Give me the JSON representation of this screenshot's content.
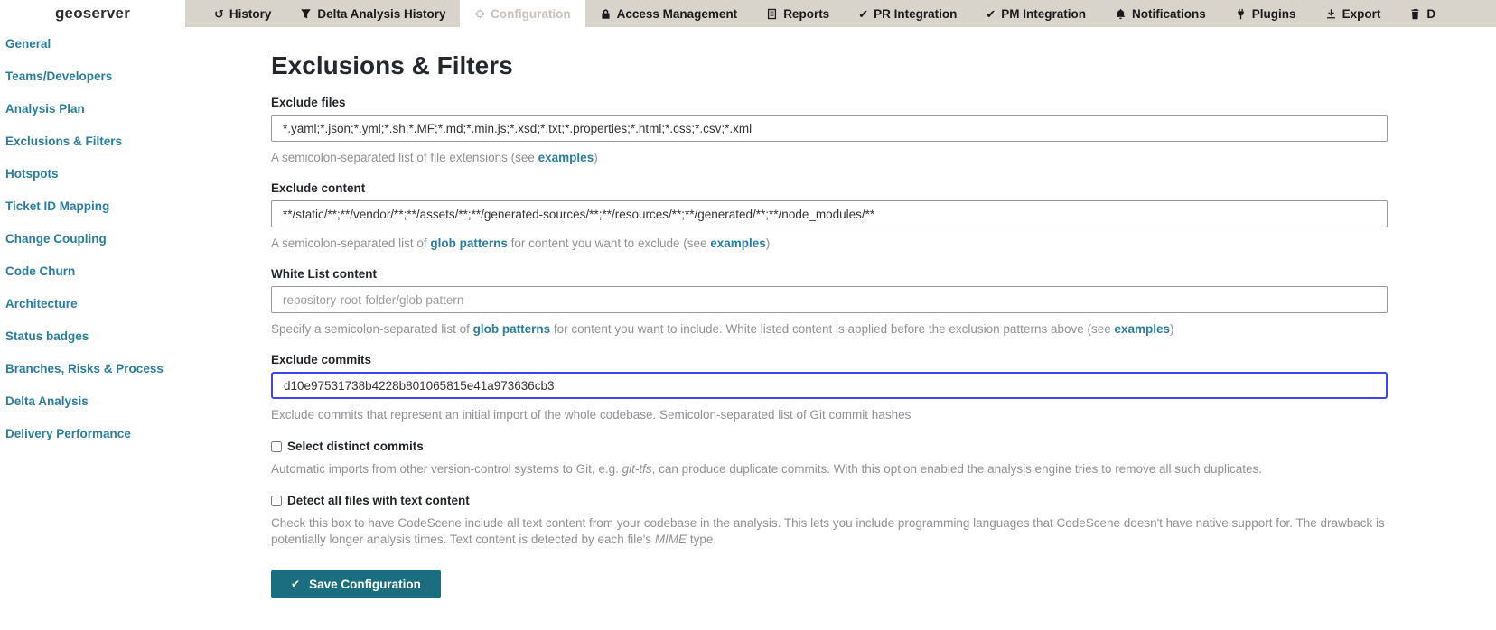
{
  "colors": {
    "accent_link": "#2a7d9c",
    "button_bg": "#1a6e80",
    "navbar_bg": "#d8d3cb",
    "focus_border": "#3e45e8"
  },
  "brand": {
    "logo": "geoserver"
  },
  "topnav": {
    "tabs": [
      {
        "label": "History",
        "icon": "history-icon",
        "active": false
      },
      {
        "label": "Delta Analysis History",
        "icon": "filter-icon",
        "active": false
      },
      {
        "label": "Configuration",
        "icon": "gears-icon",
        "active": true
      },
      {
        "label": "Access Management",
        "icon": "lock-icon",
        "active": false
      },
      {
        "label": "Reports",
        "icon": "report-icon",
        "active": false
      },
      {
        "label": "PR Integration",
        "icon": "check-icon",
        "active": false
      },
      {
        "label": "PM Integration",
        "icon": "check-icon",
        "active": false
      },
      {
        "label": "Notifications",
        "icon": "bell-icon",
        "active": false
      },
      {
        "label": "Plugins",
        "icon": "plug-icon",
        "active": false
      },
      {
        "label": "Export",
        "icon": "download-icon",
        "active": false
      },
      {
        "label": "D",
        "icon": "trash-icon",
        "active": false,
        "truncated": true
      }
    ]
  },
  "sidebar": {
    "items": [
      {
        "label": "General"
      },
      {
        "label": "Teams/Developers"
      },
      {
        "label": "Analysis Plan"
      },
      {
        "label": "Exclusions & Filters"
      },
      {
        "label": "Hotspots"
      },
      {
        "label": "Ticket ID Mapping"
      },
      {
        "label": "Change Coupling"
      },
      {
        "label": "Code Churn"
      },
      {
        "label": "Architecture"
      },
      {
        "label": "Status badges"
      },
      {
        "label": "Branches, Risks & Process"
      },
      {
        "label": "Delta Analysis"
      },
      {
        "label": "Delivery Performance"
      }
    ]
  },
  "page": {
    "title": "Exclusions & Filters"
  },
  "form": {
    "exclude_files": {
      "label": "Exclude files",
      "value": "*.yaml;*.json;*.yml;*.sh;*.MF;*.md;*.min.js;*.xsd;*.txt;*.properties;*.html;*.css;*.csv;*.xml",
      "help_prefix": "A semicolon-separated list of file extensions (see ",
      "help_link": "examples",
      "help_suffix": ")"
    },
    "exclude_content": {
      "label": "Exclude content",
      "value": "**/static/**;**/vendor/**;**/assets/**;**/generated-sources/**;**/resources/**;**/generated/**;**/node_modules/**",
      "help_prefix": "A semicolon-separated list of ",
      "help_link1": "glob patterns",
      "help_mid": " for content you want to exclude (see ",
      "help_link2": "examples",
      "help_suffix": ")"
    },
    "white_list": {
      "label": "White List content",
      "placeholder": "repository-root-folder/glob pattern",
      "help_prefix": "Specify a semicolon-separated list of ",
      "help_link1": "glob patterns",
      "help_mid": " for content you want to include. White listed content is applied before the exclusion patterns above (see ",
      "help_link2": "examples",
      "help_suffix": ")"
    },
    "exclude_commits": {
      "label": "Exclude commits",
      "value": "d10e97531738b4228b801065815e41a973636cb3",
      "help": "Exclude commits that represent an initial import of the whole codebase. Semicolon-separated list of Git commit hashes"
    },
    "select_distinct": {
      "label": "Select distinct commits",
      "checked": false,
      "help_prefix": "Automatic imports from other version-control systems to Git, e.g. ",
      "help_em": "git-tfs",
      "help_suffix": ", can produce duplicate commits. With this option enabled the analysis engine tries to remove all such duplicates."
    },
    "detect_text": {
      "label": "Detect all files with text content",
      "checked": false,
      "help_prefix": "Check this box to have CodeScene include all text content from your codebase in the analysis. This lets you include programming languages that CodeScene doesn't have native support for. The drawback is potentially longer analysis times. Text content is detected by each file's ",
      "help_em": "MIME",
      "help_suffix": " type."
    },
    "save_button": "Save Configuration"
  }
}
